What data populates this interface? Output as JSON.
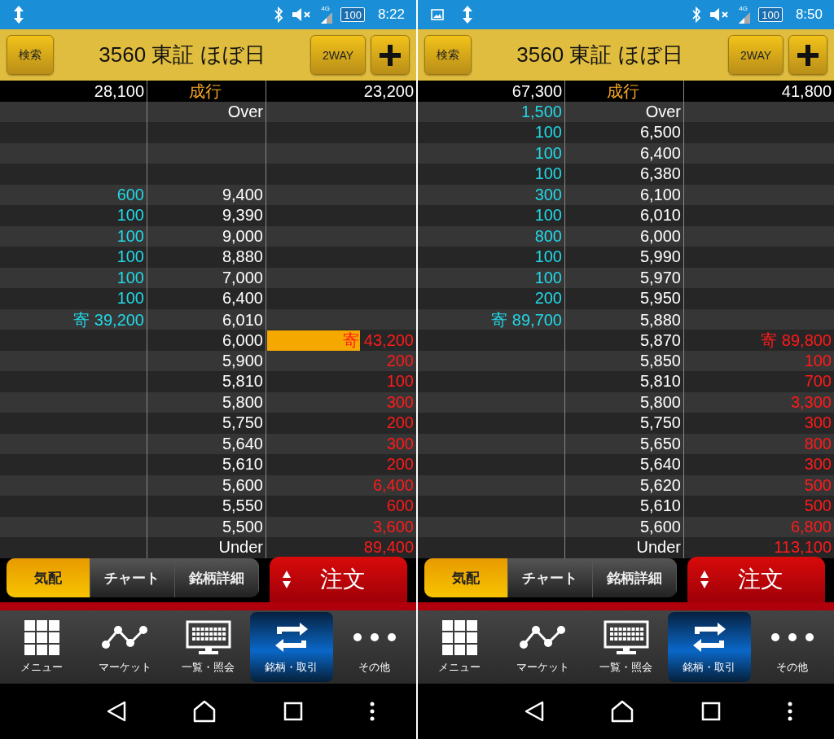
{
  "screens": [
    {
      "status_bar": {
        "notifications": [
          {
            "kind": "updown"
          }
        ],
        "network": "4G",
        "battery": "100",
        "time": "8:22"
      },
      "header": {
        "search_button": "検索",
        "title": "3560 東証 ほぼ日",
        "mode_button": "2WAY"
      },
      "board": {
        "market_row": {
          "bid": "28,100",
          "price": "成行",
          "ask": "23,200"
        },
        "rows": [
          {
            "price": "Over",
            "highlighted": false
          },
          {
            "highlighted": false
          },
          {
            "highlighted": false
          },
          {
            "highlighted": false
          },
          {
            "bid": "600",
            "price": "9,400",
            "highlighted": false
          },
          {
            "bid": "100",
            "price": "9,390",
            "highlighted": false
          },
          {
            "bid": "100",
            "price": "9,000",
            "highlighted": false
          },
          {
            "bid": "100",
            "price": "8,880",
            "highlighted": false
          },
          {
            "bid": "100",
            "price": "7,000",
            "highlighted": false
          },
          {
            "bid": "100",
            "price": "6,400",
            "highlighted": false
          },
          {
            "bid": "寄 39,200",
            "price": "6,010",
            "highlighted": false
          },
          {
            "price": "6,000",
            "ask": "寄 43,200",
            "highlighted": true
          },
          {
            "price": "5,900",
            "ask": "200",
            "highlighted": false
          },
          {
            "price": "5,810",
            "ask": "100",
            "highlighted": false
          },
          {
            "price": "5,800",
            "ask": "300",
            "highlighted": false
          },
          {
            "price": "5,750",
            "ask": "200",
            "highlighted": false
          },
          {
            "price": "5,640",
            "ask": "300",
            "highlighted": false
          },
          {
            "price": "5,610",
            "ask": "200",
            "highlighted": false
          },
          {
            "price": "5,600",
            "ask": "6,400",
            "highlighted": false
          },
          {
            "price": "5,550",
            "ask": "600",
            "highlighted": false
          },
          {
            "price": "5,500",
            "ask": "3,600",
            "highlighted": false
          },
          {
            "price": "Under",
            "ask": "89,400",
            "highlighted": false
          }
        ]
      },
      "tabs": [
        {
          "label": "気配",
          "selected": true
        },
        {
          "label": "チャート",
          "selected": false
        },
        {
          "label": "銘柄詳細",
          "selected": false
        }
      ],
      "order_button": "注文",
      "nav": [
        {
          "kind": "grid",
          "label": "メニュー",
          "selected": false
        },
        {
          "kind": "chart",
          "label": "マーケット",
          "selected": false
        },
        {
          "kind": "monitor",
          "label": "一覧・照会",
          "selected": false
        },
        {
          "kind": "swap",
          "label": "銘柄・取引",
          "selected": true
        },
        {
          "kind": "dots",
          "label": "その他",
          "selected": false
        }
      ]
    },
    {
      "status_bar": {
        "notifications": [
          {
            "kind": "image"
          },
          {
            "kind": "updown"
          }
        ],
        "network": "4G",
        "battery": "100",
        "time": "8:50"
      },
      "header": {
        "search_button": "検索",
        "title": "3560 東証 ほぼ日",
        "mode_button": "2WAY"
      },
      "board": {
        "market_row": {
          "bid": "67,300",
          "price": "成行",
          "ask": "41,800"
        },
        "rows": [
          {
            "bid": "1,500",
            "price": "Over",
            "highlighted": false
          },
          {
            "bid": "100",
            "price": "6,500",
            "highlighted": false
          },
          {
            "bid": "100",
            "price": "6,400",
            "highlighted": false
          },
          {
            "bid": "100",
            "price": "6,380",
            "highlighted": false
          },
          {
            "bid": "300",
            "price": "6,100",
            "highlighted": false
          },
          {
            "bid": "100",
            "price": "6,010",
            "highlighted": false
          },
          {
            "bid": "800",
            "price": "6,000",
            "highlighted": false
          },
          {
            "bid": "100",
            "price": "5,990",
            "highlighted": false
          },
          {
            "bid": "100",
            "price": "5,970",
            "highlighted": false
          },
          {
            "bid": "200",
            "price": "5,950",
            "highlighted": false
          },
          {
            "bid": "寄 89,700",
            "price": "5,880",
            "highlighted": false
          },
          {
            "price": "5,870",
            "ask": "寄 89,800",
            "highlighted": false
          },
          {
            "price": "5,850",
            "ask": "100",
            "highlighted": false
          },
          {
            "price": "5,810",
            "ask": "700",
            "highlighted": false
          },
          {
            "price": "5,800",
            "ask": "3,300",
            "highlighted": false
          },
          {
            "price": "5,750",
            "ask": "300",
            "highlighted": false
          },
          {
            "price": "5,650",
            "ask": "800",
            "highlighted": false
          },
          {
            "price": "5,640",
            "ask": "300",
            "highlighted": false
          },
          {
            "price": "5,620",
            "ask": "500",
            "highlighted": false
          },
          {
            "price": "5,610",
            "ask": "500",
            "highlighted": false
          },
          {
            "price": "5,600",
            "ask": "6,800",
            "highlighted": false
          },
          {
            "price": "Under",
            "ask": "113,100",
            "highlighted": false
          }
        ]
      },
      "tabs": [
        {
          "label": "気配",
          "selected": true
        },
        {
          "label": "チャート",
          "selected": false
        },
        {
          "label": "銘柄詳細",
          "selected": false
        }
      ],
      "order_button": "注文",
      "nav": [
        {
          "kind": "grid",
          "label": "メニュー",
          "selected": false
        },
        {
          "kind": "chart",
          "label": "マーケット",
          "selected": false
        },
        {
          "kind": "monitor",
          "label": "一覧・照会",
          "selected": false
        },
        {
          "kind": "swap",
          "label": "銘柄・取引",
          "selected": true
        },
        {
          "kind": "dots",
          "label": "その他",
          "selected": false
        }
      ]
    }
  ]
}
